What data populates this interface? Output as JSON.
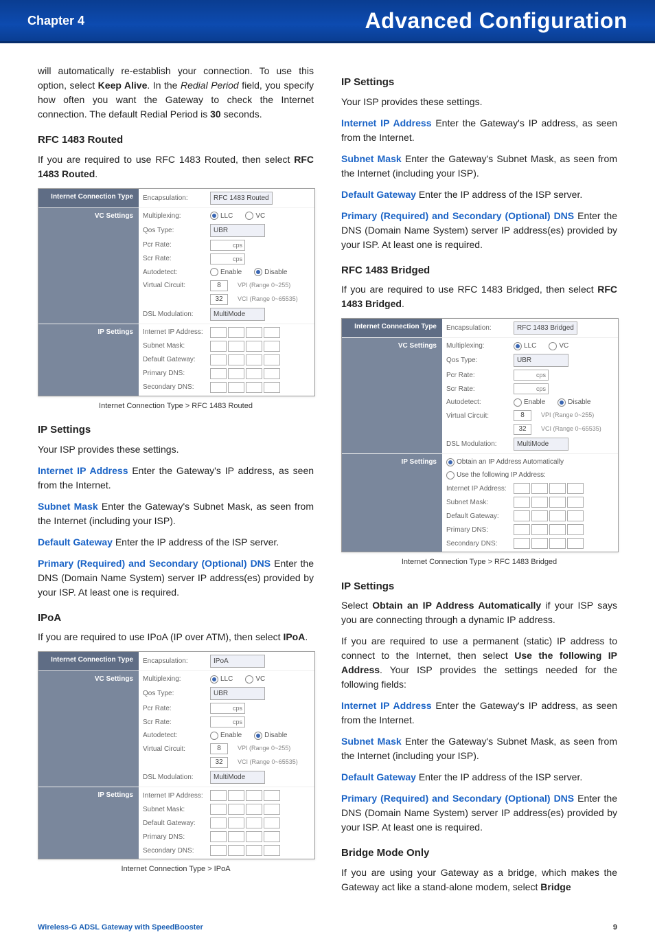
{
  "header": {
    "chapter": "Chapter 4",
    "title": "Advanced Configuration"
  },
  "footer": {
    "product": "Wireless-G ADSL Gateway with SpeedBooster",
    "page": "9"
  },
  "left": {
    "intro": "will automatically re-establish your connection. To use this option, select ",
    "intro_b1": "Keep Alive",
    "intro2": ". In the ",
    "intro_i": "Redial Period",
    "intro3": " field, you specify how often you want the Gateway to check the Internet connection. The default Redial Period is ",
    "intro_b2": "30",
    "intro4": " seconds.",
    "h_rfc_r": "RFC 1483 Routed",
    "rfc_r_p": "If you are required to use RFC 1483 Routed, then select ",
    "rfc_r_b": "RFC 1483 Routed",
    "rfc_r_p2": ".",
    "cap1": "Internet Connection Type > RFC 1483 Routed",
    "h_ip1": "IP Settings",
    "ip_intro": "Your ISP provides these settings.",
    "iip_t": "Internet IP Address",
    "iip_d": "  Enter the Gateway's IP address, as seen from the Internet.",
    "sm_t": "Subnet Mask",
    "sm_d": "  Enter the Gateway's Subnet Mask, as seen from the Internet (including your ISP).",
    "dg_t": "Default Gateway",
    "dg_d": "  Enter the IP address of the ISP server.",
    "dns_t": "Primary (Required) and Secondary (Optional) DNS",
    "dns_d": "  Enter the DNS (Domain Name System) server IP address(es) provided by your ISP. At least one is required.",
    "h_ipoa": "IPoA",
    "ipoa_p": "If you are required to use IPoA (IP over ATM), then select ",
    "ipoa_b": "IPoA",
    "ipoa_p2": ".",
    "cap2": "Internet Connection Type > IPoA"
  },
  "right": {
    "h_ip1": "IP Settings",
    "ip_intro": "Your ISP provides these settings.",
    "iip_t": "Internet IP Address",
    "iip_d": "  Enter the Gateway's IP address, as seen from the Internet.",
    "sm_t": "Subnet Mask",
    "sm_d": "  Enter the Gateway's Subnet Mask, as seen from the Internet (including your ISP).",
    "dg_t": "Default Gateway",
    "dg_d": "  Enter the IP address of the ISP server.",
    "dns_t": "Primary (Required) and Secondary (Optional) DNS",
    "dns_d": "  Enter the DNS (Domain Name System) server IP address(es) provided by your ISP. At least one is required.",
    "h_rfc_b": "RFC 1483 Bridged",
    "rfc_b_p": "If you are required to use RFC 1483 Bridged, then select ",
    "rfc_b_b": "RFC 1483 Bridged",
    "rfc_b_p2": ".",
    "cap1": "Internet Connection Type > RFC 1483 Bridged",
    "h_ip2": "IP Settings",
    "ip2_p1a": "Select ",
    "ip2_b1": "Obtain an IP Address Automatically",
    "ip2_p1b": " if your ISP says you are connecting through a dynamic IP address.",
    "ip2_p2a": "If you are required to use a permanent (static) IP address to connect to the Internet, then select ",
    "ip2_b2": "Use the following IP Address",
    "ip2_p2b": ". Your ISP provides the settings needed for the following fields:",
    "h_bridge": "Bridge Mode Only",
    "bridge_p": "If you are using your Gateway as a bridge, which makes the Gateway act like a stand-alone modem, select ",
    "bridge_b": "Bridge"
  },
  "shot": {
    "ict": "Internet Connection Type",
    "vc": "VC Settings",
    "ips": "IP Settings",
    "encap": "Encapsulation:",
    "mux": "Multiplexing:",
    "qos": "Qos Type:",
    "pcr": "Pcr Rate:",
    "scr": "Scr Rate:",
    "auto": "Autodetect:",
    "vcirc": "Virtual Circuit:",
    "dsl": "DSL Modulation:",
    "iip": "Internet IP Address:",
    "sm": "Subnet Mask:",
    "dg": "Default Gateway:",
    "pdns": "Primary DNS:",
    "sdns": "Secondary DNS:",
    "llc": "LLC",
    "vclab": "VC",
    "ubr": "UBR",
    "enable": "Enable",
    "disable": "Disable",
    "vpi": "VPI (Range 0~255)",
    "vci": "VCI (Range 0~65535)",
    "vpi_v": "8",
    "vci_v": "32",
    "mm": "MultiMode",
    "cps": "cps",
    "enc_routed": "RFC 1483 Routed",
    "enc_ipoa": "IPoA",
    "enc_bridged": "RFC 1483 Bridged",
    "obtain": "Obtain an IP Address Automatically",
    "usefollow": "Use the following IP Address:"
  }
}
